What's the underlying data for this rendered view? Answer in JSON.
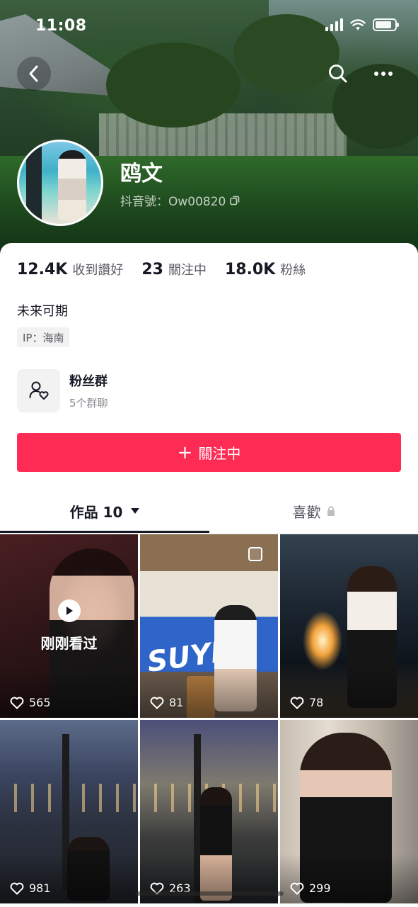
{
  "status_bar": {
    "time": "11:08"
  },
  "header": {
    "nickname": "鸥文",
    "douyin_id": "抖音號：Ow00820"
  },
  "stats": [
    {
      "value": "12.4K",
      "label": "收到讚好"
    },
    {
      "value": "23",
      "label": "關注中"
    },
    {
      "value": "18.0K",
      "label": "粉絲"
    }
  ],
  "bio": "未来可期",
  "ip": "IP：海南",
  "fans_group": {
    "title": "粉丝群",
    "subtitle": "5个群聊"
  },
  "follow_button": {
    "icon": "+",
    "label": "關注中"
  },
  "tabs": {
    "works": "作品 10",
    "likes": "喜歡"
  },
  "grid": {
    "watched_label": "刚刚看过",
    "surf_text": "SUYF",
    "tiles": [
      {
        "likes": "565"
      },
      {
        "likes": "81"
      },
      {
        "likes": "78"
      },
      {
        "likes": "981"
      },
      {
        "likes": "263"
      },
      {
        "likes": "299"
      }
    ]
  },
  "colors": {
    "accent": "#fe2c55",
    "text": "#161823",
    "secondary": "#5a5b63"
  },
  "icons": [
    "back-icon",
    "search-icon",
    "more-icon",
    "copy-icon",
    "fans-group-icon",
    "play-icon",
    "heart-icon",
    "lock-icon",
    "caret-down-icon"
  ]
}
